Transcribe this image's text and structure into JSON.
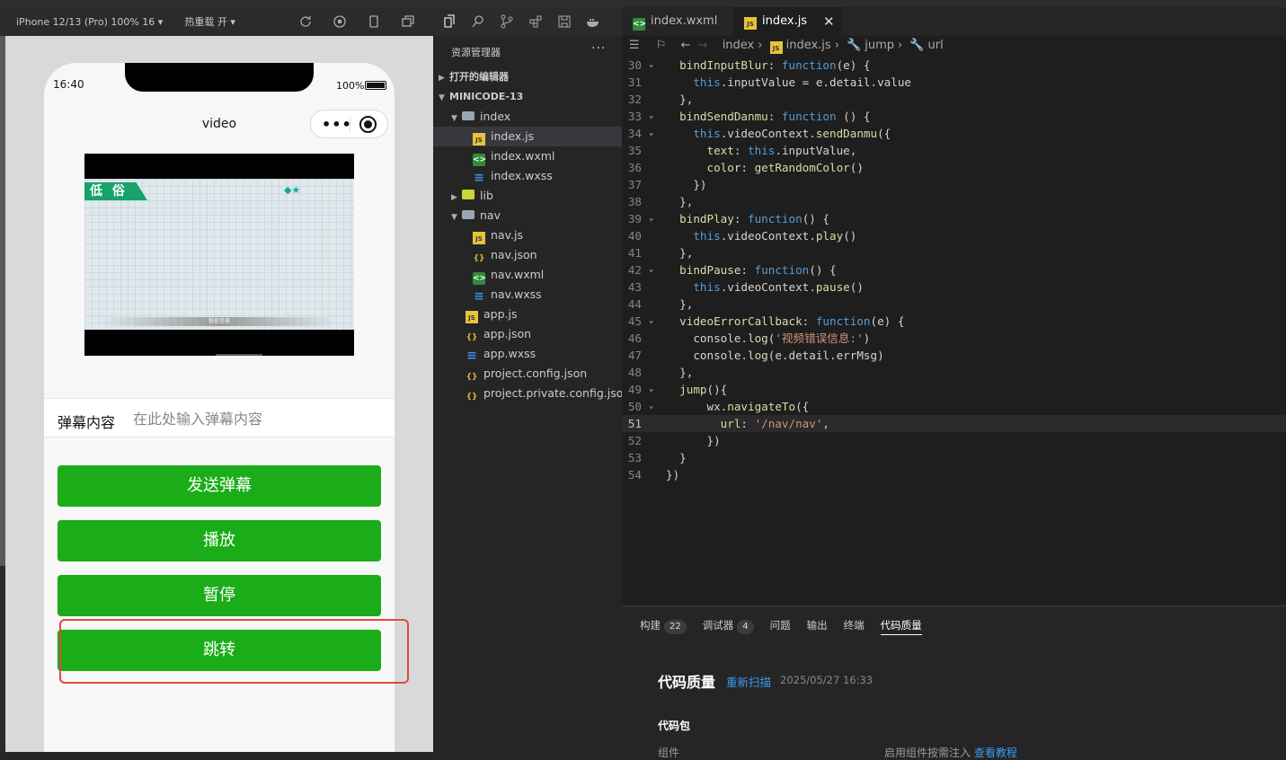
{
  "simulator": {
    "device": "iPhone 12/13 (Pro) 100% 16 ▾",
    "hot_reload": "热重载 开 ▾"
  },
  "phone": {
    "time": "16:40",
    "battery": "100%",
    "nav_title": "video",
    "video_tag": "低 俗",
    "video_bar_text": "低俗信息",
    "danmu_label": "弹幕内容",
    "danmu_placeholder": "在此处输入弹幕内容",
    "buttons": [
      "发送弹幕",
      "播放",
      "暂停",
      "跳转"
    ],
    "button_color": "#1aad19",
    "highlight_color": "#e0493a"
  },
  "explorer": {
    "title": "资源管理器",
    "open_editors": "打开的编辑器",
    "project": "MINICODE-13",
    "items": [
      {
        "label": "index",
        "type": "folder"
      },
      {
        "label": "index.js",
        "type": "js"
      },
      {
        "label": "index.wxml",
        "type": "wxml"
      },
      {
        "label": "index.wxss",
        "type": "wxss"
      },
      {
        "label": "lib",
        "type": "lib"
      },
      {
        "label": "nav",
        "type": "folder"
      },
      {
        "label": "nav.js",
        "type": "js"
      },
      {
        "label": "nav.json",
        "type": "json"
      },
      {
        "label": "nav.wxml",
        "type": "wxml"
      },
      {
        "label": "nav.wxss",
        "type": "wxss"
      },
      {
        "label": "app.js",
        "type": "js"
      },
      {
        "label": "app.json",
        "type": "json"
      },
      {
        "label": "app.wxss",
        "type": "wxss"
      },
      {
        "label": "project.config.json",
        "type": "json"
      },
      {
        "label": "project.private.config.json",
        "type": "json"
      }
    ]
  },
  "editor": {
    "tabs": [
      "index.wxml",
      "index.js"
    ],
    "active_tab": "index.js",
    "breadcrumb": [
      "index",
      "index.js",
      "jump",
      "url"
    ],
    "current_line": 51,
    "lines": [
      {
        "n": "30",
        "fold": true,
        "code": "  bindInputBlur: function(e) {"
      },
      {
        "n": "31",
        "fold": false,
        "code": "    this.inputValue = e.detail.value"
      },
      {
        "n": "32",
        "fold": false,
        "code": "  },"
      },
      {
        "n": "33",
        "fold": true,
        "code": "  bindSendDanmu: function () {"
      },
      {
        "n": "34",
        "fold": true,
        "code": "    this.videoContext.sendDanmu({"
      },
      {
        "n": "35",
        "fold": false,
        "code": "      text: this.inputValue,"
      },
      {
        "n": "36",
        "fold": false,
        "code": "      color: getRandomColor()"
      },
      {
        "n": "37",
        "fold": false,
        "code": "    })"
      },
      {
        "n": "38",
        "fold": false,
        "code": "  },"
      },
      {
        "n": "39",
        "fold": true,
        "code": "  bindPlay: function() {"
      },
      {
        "n": "40",
        "fold": false,
        "code": "    this.videoContext.play()"
      },
      {
        "n": "41",
        "fold": false,
        "code": "  },"
      },
      {
        "n": "42",
        "fold": true,
        "code": "  bindPause: function() {"
      },
      {
        "n": "43",
        "fold": false,
        "code": "    this.videoContext.pause()"
      },
      {
        "n": "44",
        "fold": false,
        "code": "  },"
      },
      {
        "n": "45",
        "fold": true,
        "code": "  videoErrorCallback: function(e) {"
      },
      {
        "n": "46",
        "fold": false,
        "code": "    console.log('视频错误信息:')"
      },
      {
        "n": "47",
        "fold": false,
        "code": "    console.log(e.detail.errMsg)"
      },
      {
        "n": "48",
        "fold": false,
        "code": "  },"
      },
      {
        "n": "49",
        "fold": true,
        "code": "  jump(){"
      },
      {
        "n": "50",
        "fold": true,
        "code": "      wx.navigateTo({"
      },
      {
        "n": "51",
        "fold": false,
        "code": "        url: '/nav/nav',"
      },
      {
        "n": "52",
        "fold": false,
        "code": "      })"
      },
      {
        "n": "53",
        "fold": false,
        "code": "  }"
      },
      {
        "n": "54",
        "fold": false,
        "code": "})"
      }
    ]
  },
  "panel": {
    "tabs": [
      {
        "label": "构建",
        "badge": "22"
      },
      {
        "label": "调试器",
        "badge": "4"
      },
      {
        "label": "问题",
        "badge": ""
      },
      {
        "label": "输出",
        "badge": ""
      },
      {
        "label": "终端",
        "badge": ""
      },
      {
        "label": "代码质量",
        "badge": ""
      }
    ],
    "active_tab": "代码质量",
    "title": "代码质量",
    "rescan": "重新扫描",
    "time": "2025/05/27 16:33",
    "section": "代码包",
    "row_left": "组件",
    "row_right": "启用组件按需注入",
    "row_link": "查看教程"
  }
}
